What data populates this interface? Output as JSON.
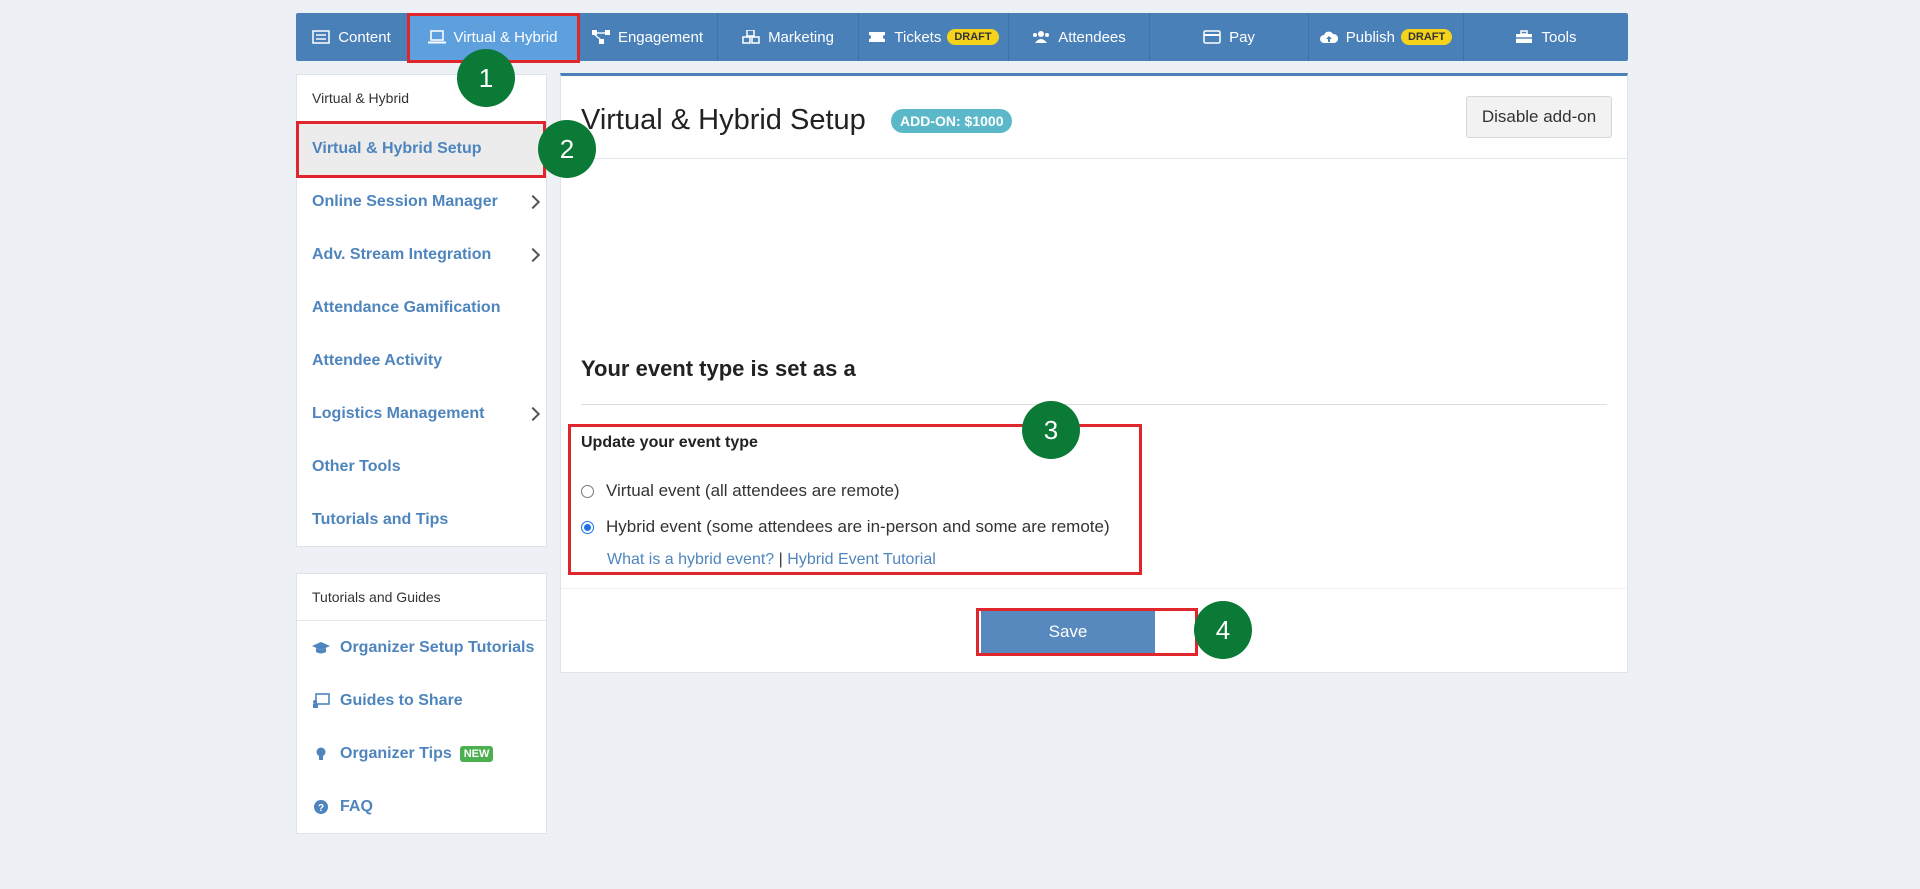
{
  "topnav": {
    "items": [
      {
        "label": "Content",
        "icon": "list-icon"
      },
      {
        "label": "Virtual & Hybrid",
        "icon": "laptop-icon",
        "active": true
      },
      {
        "label": "Engagement",
        "icon": "network-icon"
      },
      {
        "label": "Marketing",
        "icon": "cubes-icon"
      },
      {
        "label": "Tickets",
        "icon": "ticket-icon",
        "badge": "DRAFT"
      },
      {
        "label": "Attendees",
        "icon": "users-icon"
      },
      {
        "label": "Pay",
        "icon": "credit-card-icon"
      },
      {
        "label": "Publish",
        "icon": "cloud-upload-icon",
        "badge": "DRAFT"
      },
      {
        "label": "Tools",
        "icon": "toolbox-icon"
      }
    ]
  },
  "sidebar": {
    "header": "Virtual & Hybrid",
    "items": [
      {
        "label": "Virtual & Hybrid Setup",
        "active": true
      },
      {
        "label": "Online Session Manager",
        "has_submenu": true
      },
      {
        "label": "Adv. Stream Integration",
        "has_submenu": true
      },
      {
        "label": "Attendance Gamification"
      },
      {
        "label": "Attendee Activity"
      },
      {
        "label": "Logistics Management",
        "has_submenu": true
      },
      {
        "label": "Other Tools"
      },
      {
        "label": "Tutorials and Tips"
      }
    ]
  },
  "guides": {
    "header": "Tutorials and Guides",
    "items": [
      {
        "label": "Organizer Setup Tutorials",
        "icon": "graduation-cap-icon"
      },
      {
        "label": "Guides to Share",
        "icon": "chalkboard-icon"
      },
      {
        "label": "Organizer Tips",
        "icon": "lightbulb-icon",
        "badge": "NEW"
      },
      {
        "label": "FAQ",
        "icon": "question-circle-icon"
      }
    ]
  },
  "main": {
    "title": "Virtual & Hybrid Setup",
    "addon_badge": "ADD-ON: $1000",
    "disable_button": "Disable add-on",
    "event_type_heading": "Your event type is set as a",
    "update_label": "Update your event type",
    "options": [
      {
        "label": "Virtual event (all attendees are remote)",
        "checked": false
      },
      {
        "label": "Hybrid event (some attendees are in-person and some are remote)",
        "checked": true
      }
    ],
    "link_what": "What is a hybrid event?",
    "link_sep": "|",
    "link_tutorial": "Hybrid Event Tutorial",
    "save_button": "Save"
  },
  "annotations": [
    "1",
    "2",
    "3",
    "4"
  ],
  "colors": {
    "nav_bg": "#4a80b8",
    "nav_active": "#5ea0de",
    "link": "#4f85bd",
    "marker": "#0b7a36",
    "highlight": "#e0262d",
    "draft_badge": "#f5d31b",
    "addon_badge": "#5bb8c9"
  }
}
